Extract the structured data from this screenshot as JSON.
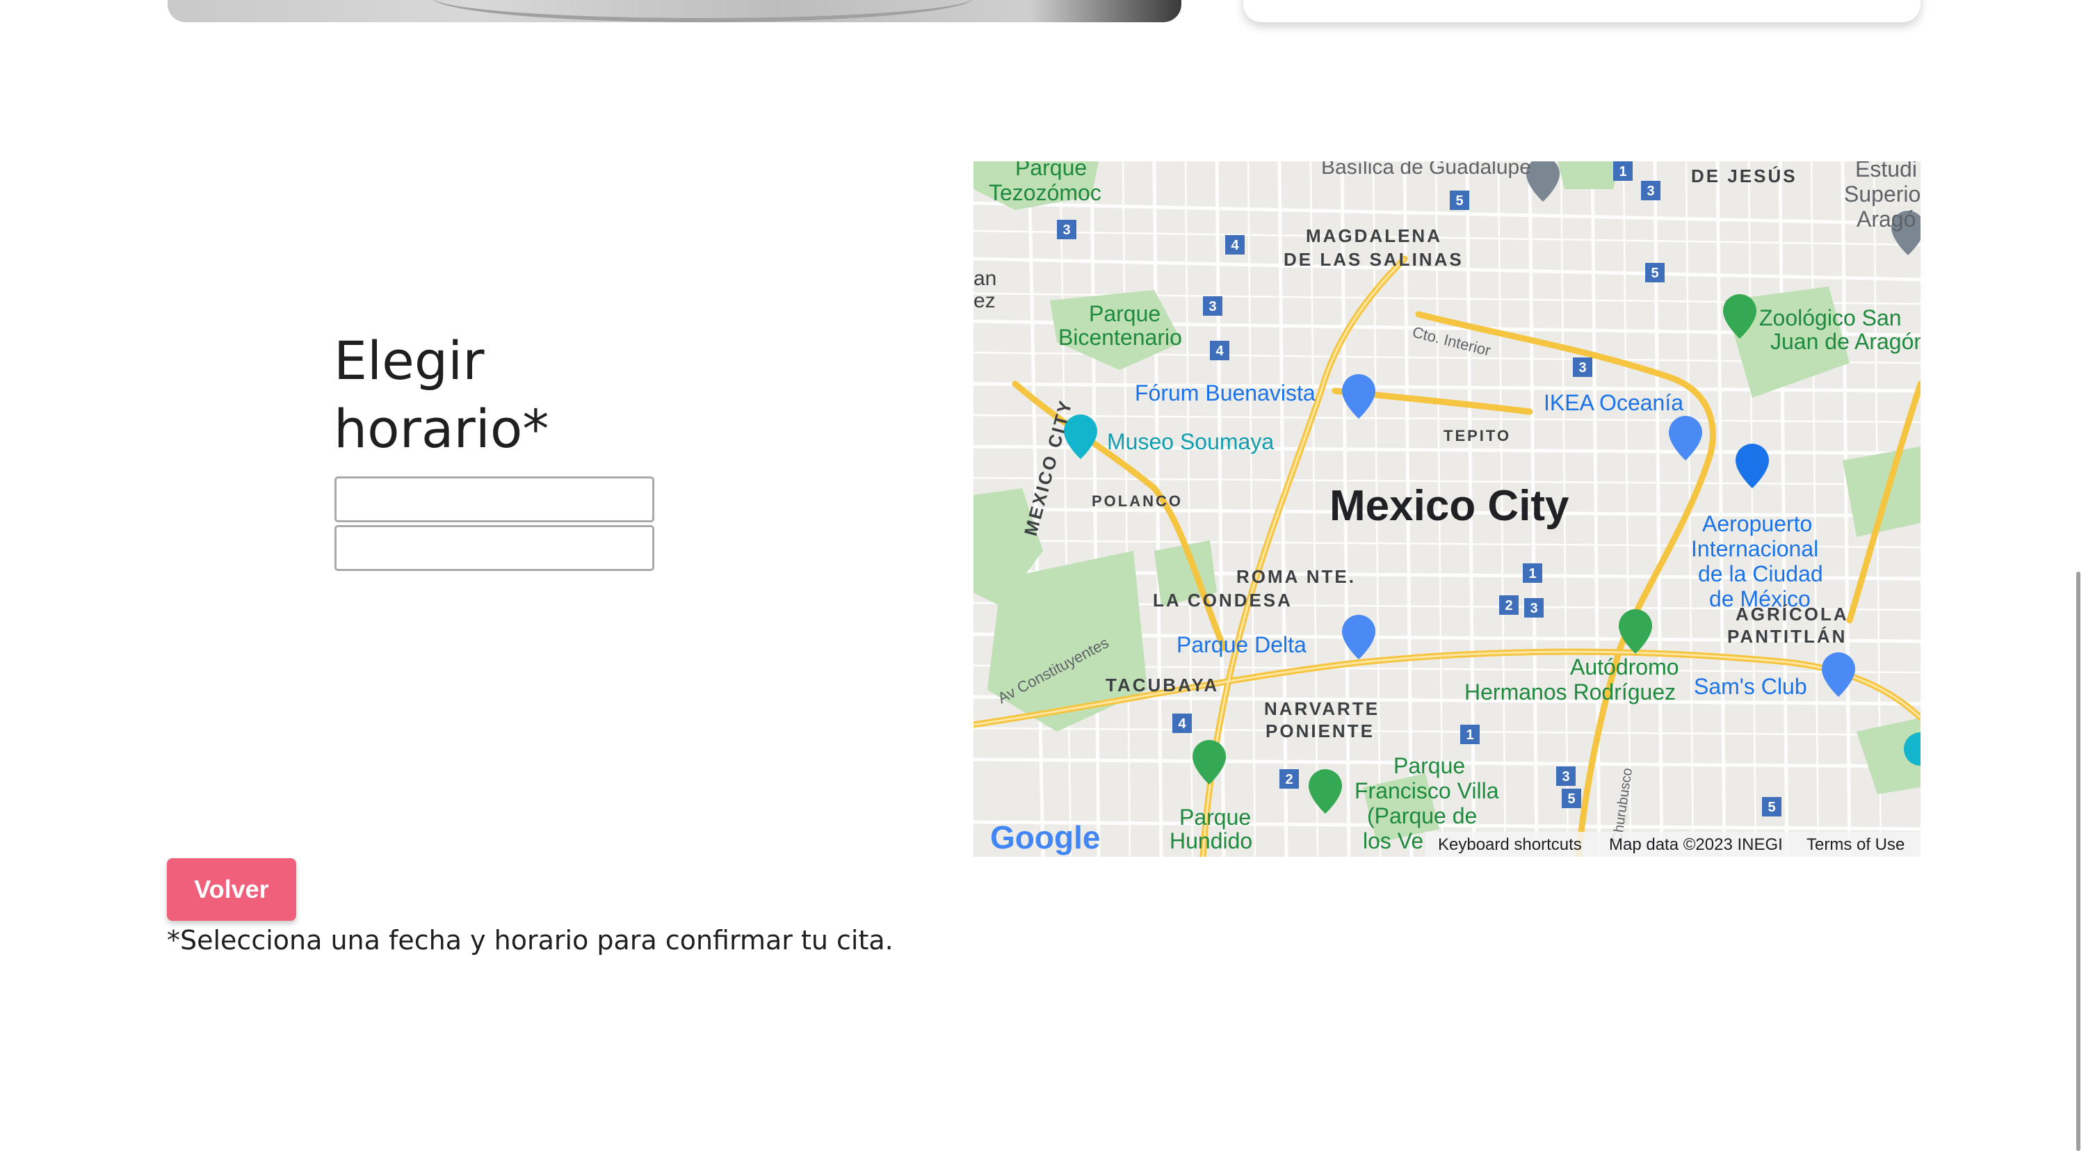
{
  "heading": {
    "line1": "Elegir",
    "line2": "horario*"
  },
  "form": {
    "field1_value": "",
    "field2_value": ""
  },
  "map": {
    "city": "Mexico City",
    "labels": {
      "basilica": "Basílica de Guadalupe",
      "parque_tez_1": "Parque",
      "parque_tez_2": "Tezozómoc",
      "de_jesus": "DE JESÚS",
      "estudios_1": "Estudi",
      "estudios_2": "Superio",
      "estudios_3": "Aragó",
      "magdalena_1": "MAGDALENA",
      "magdalena_2": "DE LAS SALINAS",
      "parque_bic_1": "Parque",
      "parque_bic_2": "Bicentenario",
      "zoologico_1": "Zoológico San",
      "zoologico_2": "Juan de Aragón",
      "cto_interior": "Cto. Interior",
      "forum": "Fórum Buenavista",
      "ikea": "IKEA Oceanía",
      "museo": "Museo Soumaya",
      "tepito": "TEPITO",
      "mexico_city_vert": "MEXICO CITY",
      "polanco": "POLANCO",
      "aeropuerto_1": "Aeropuerto",
      "aeropuerto_2": "Internacional",
      "aeropuerto_3": "de la Ciudad",
      "aeropuerto_4": "de México",
      "roma": "ROMA NTE.",
      "condesa": "LA CONDESA",
      "agricola_1": "AGRÍCOLA",
      "agricola_2": "PANTITLÁN",
      "parque_delta": "Parque Delta",
      "autodromo_1": "Autódromo",
      "autodromo_2": "Hermanos Rodríguez",
      "sams": "Sam's Club",
      "av_const": "Av Constituyentes",
      "tacubaya": "TACUBAYA",
      "narvarte_1": "NARVARTE",
      "narvarte_2": "PONIENTE",
      "parque_fv_1": "Parque",
      "parque_fv_2": "Francisco Villa",
      "parque_fv_3": "(Parque de",
      "parque_fv_4": "los Ve",
      "parque_hundido_1": "Parque",
      "parque_hundido_2": "Hundido",
      "churubusco": "Churubusco",
      "left_edge_1": "an",
      "left_edge_2": "ez"
    },
    "route_badges": [
      "1",
      "3",
      "5",
      "3",
      "4",
      "3",
      "4",
      "5",
      "3",
      "1",
      "2",
      "3",
      "4",
      "2",
      "1",
      "3",
      "5",
      "5"
    ],
    "google": "Google",
    "footer": {
      "shortcuts": "Keyboard shortcuts",
      "map_data": "Map data ©2023 INEGI",
      "terms": "Terms of Use"
    }
  },
  "actions": {
    "back_label": "Volver"
  },
  "note": "*Selecciona una fecha y horario para confirmar tu cita.",
  "colors": {
    "accent": "#f0607a",
    "map_road": "#f5c542",
    "map_park": "#b7ddb0",
    "map_text_green": "#1e8a3e",
    "map_text_blue": "#1a73e8"
  }
}
